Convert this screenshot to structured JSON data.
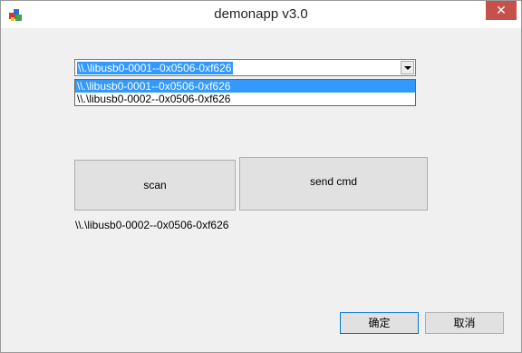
{
  "window": {
    "title": "demonapp v3.0",
    "close_label": "✕"
  },
  "device_select": {
    "value": "\\\\.\\libusb0-0001--0x0506-0xf626",
    "options": [
      "\\\\.\\libusb0-0001--0x0506-0xf626",
      "\\\\.\\libusb0-0002--0x0506-0xf626"
    ]
  },
  "buttons": {
    "scan": "scan",
    "send_cmd": "send cmd",
    "ok": "确定",
    "cancel": "取消"
  },
  "status_text": "\\\\.\\libusb0-0002--0x0506-0xf626"
}
